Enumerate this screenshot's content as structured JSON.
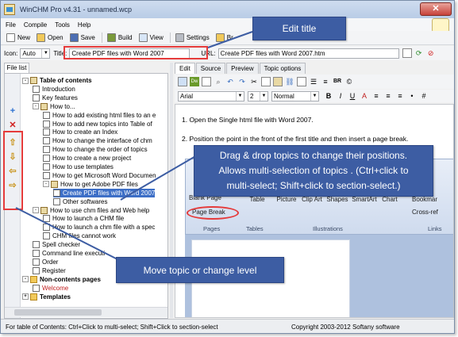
{
  "window": {
    "title": "WinCHM Pro v4.31 - unnamed.wcp",
    "close_label": "✕"
  },
  "menu": [
    "File",
    "Compile",
    "Tools",
    "Help"
  ],
  "toolbar": {
    "new": "New",
    "open": "Open",
    "save": "Save",
    "build": "Build",
    "view": "View",
    "settings": "Settings",
    "truncated": "Br"
  },
  "props": {
    "icon_label": "Icon:",
    "icon_value": "Auto",
    "title_label": "Title:",
    "title_value": "Create PDF files with Word 2007",
    "url_label": "URL:",
    "url_value": "Create PDF files with Word 2007.htm"
  },
  "left": {
    "tab_label": "File list",
    "side_buttons": [
      "+",
      "✕",
      "⇧",
      "⇩",
      "⇦",
      "⇨"
    ],
    "tree": [
      {
        "label": "Table of contents",
        "level": 0,
        "type": "book",
        "bold": true,
        "exp": "-"
      },
      {
        "label": "Introduction",
        "level": 1,
        "type": "page"
      },
      {
        "label": "Key features",
        "level": 1,
        "type": "page"
      },
      {
        "label": "How to...",
        "level": 1,
        "type": "book",
        "exp": "-"
      },
      {
        "label": "How to add existing html files to an e",
        "level": 2,
        "type": "page"
      },
      {
        "label": "How to add new topics into Table of",
        "level": 2,
        "type": "page"
      },
      {
        "label": "How to create an Index",
        "level": 2,
        "type": "page"
      },
      {
        "label": "How to change the interface of chm",
        "level": 2,
        "type": "page"
      },
      {
        "label": "How to change the order of topics",
        "level": 2,
        "type": "page"
      },
      {
        "label": "How to create a new project",
        "level": 2,
        "type": "page"
      },
      {
        "label": "How to use templates",
        "level": 2,
        "type": "page"
      },
      {
        "label": "How to get Microsoft Word Documen",
        "level": 2,
        "type": "page"
      },
      {
        "label": "How to get Adobe PDF files",
        "level": 2,
        "type": "book",
        "exp": "-"
      },
      {
        "label": "Create PDF files with Word 2007",
        "level": 3,
        "type": "page",
        "selected": true
      },
      {
        "label": "Other softwares",
        "level": 3,
        "type": "page"
      },
      {
        "label": "How to use chm files and Web help",
        "level": 1,
        "type": "book",
        "exp": "-"
      },
      {
        "label": "How to launch a CHM file",
        "level": 2,
        "type": "page"
      },
      {
        "label": "How to launch a chm file with a spec",
        "level": 2,
        "type": "page"
      },
      {
        "label": "CHM files cannot work",
        "level": 2,
        "type": "page"
      },
      {
        "label": "Spell checker",
        "level": 1,
        "type": "page"
      },
      {
        "label": "Command line executi",
        "level": 1,
        "type": "page"
      },
      {
        "label": "Order",
        "level": 1,
        "type": "page"
      },
      {
        "label": "Register",
        "level": 1,
        "type": "page"
      },
      {
        "label": "Non-contents pages",
        "level": 0,
        "type": "folder",
        "bold": true,
        "exp": "-"
      },
      {
        "label": "Welcome",
        "level": 1,
        "type": "page",
        "red": true
      },
      {
        "label": "Templates",
        "level": 0,
        "type": "folder",
        "bold": true,
        "exp": "+"
      }
    ]
  },
  "right": {
    "tabs": [
      "Edit",
      "Source",
      "Preview",
      "Topic options"
    ],
    "font_name": "Arial",
    "font_size": "2",
    "style": "Normal",
    "fmt_glyphs": [
      "B",
      "I",
      "U",
      "A",
      "BR",
      "©"
    ],
    "line1": "1. Open the Single html file with Word 2007.",
    "line2": "2. Position the point in the front of the first title and then insert a page break.",
    "ribbon": {
      "blank_page": "Blank Page",
      "page_break": "Page Break",
      "pages_group": "Pages",
      "table": "Table",
      "tables_group": "Tables",
      "picture": "Picture",
      "clip_art": "Clip Art",
      "shapes": "Shapes",
      "smartart": "SmartArt",
      "chart": "Chart",
      "illustrations_group": "Illustrations",
      "bookmark": "Bookmar",
      "cross_ref": "Cross-ref",
      "links_group": "Links"
    }
  },
  "status": {
    "left": "For table of Contents: Ctrl+Click to multi-select; Shift+Click to section-select",
    "right": "Copyright 2003-2012 Softany software"
  },
  "callouts": {
    "edit_title": "Edit title",
    "drag_line1": "Drag & drop topics to change their positions.",
    "drag_line2": "Allows multi-selection of topics . (Ctrl+click to",
    "drag_line3": "multi-select; Shift+click to section-select.)",
    "move": "Move topic or change level"
  },
  "colors": {
    "callout": "#3d5da3",
    "highlight": "#e53b3b",
    "selection": "#3d6fc7"
  }
}
